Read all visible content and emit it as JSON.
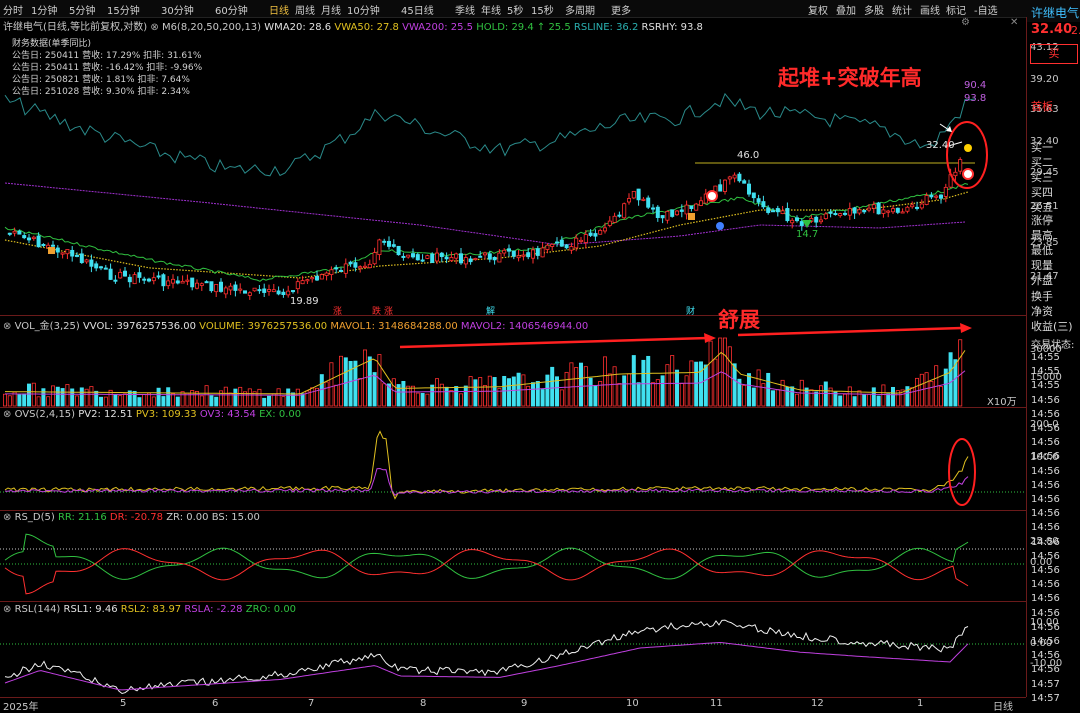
{
  "toolbar": {
    "periods": [
      "分时",
      "1分钟",
      "5分钟",
      "15分钟",
      "30分钟",
      "60分钟",
      "日线",
      "周线",
      "月线",
      "10分钟",
      "45日线",
      "季线",
      "年线",
      "5秒",
      "15秒",
      "多周期",
      "更多"
    ],
    "active_index": 6,
    "right_items": [
      "复权",
      "叠加",
      "多股",
      "统计",
      "画线",
      "标记"
    ],
    "watchlist_btn": "-自选"
  },
  "stock": {
    "name": "许继电气",
    "price": "32.40",
    "price_suffix": "2.",
    "buy_btn": "买",
    "first_board": "首板"
  },
  "main_pane": {
    "title": "许继电气(日线,等比前复权,对数)",
    "ma_title": "M6(8,20,50,200,13)",
    "wma20": "WMA20: 28.6",
    "vwa50": "VWA50: 27.8",
    "vwa200": "VWA200: 25.5",
    "hold": "HOLD: 29.4 ↑ 25.5",
    "rsline": "RSLINE: 36.2",
    "rsrhy": "RSRHY: 93.8",
    "fin_title": "财务数据(单季同比)",
    "fin_rows": [
      "公告日: 250411  营收: 17.29%  扣非: 31.61%",
      "公告日: 250411  营收: -16.42%  扣非: -9.96%",
      "公告日: 250821  营收: 1.81%  扣非: 7.64%",
      "公告日: 251028  营收: 9.30%  扣非: 2.34%"
    ],
    "yticks": [
      "43.12",
      "39.20",
      "35.63",
      "32.40",
      "29.45",
      "26.51",
      "23.85",
      "21.47"
    ],
    "marks": {
      "high_46": "46.0",
      "low_1989": "19.89",
      "low_147": "14.7",
      "price_3240": "32.40",
      "rs_904": "90.4",
      "rs_938": "93.8"
    },
    "event_tags": [
      "涨",
      "跌",
      "涨",
      "解",
      "财"
    ]
  },
  "vol_pane": {
    "title": "VOL_金(3,25)",
    "vvol": "VVOL: 3976257536.00",
    "volume": "VOLUME: 3976257536.00",
    "mavol1": "MAVOL1: 3148684288.00",
    "mavol2": "MAVOL2: 1406546944.00",
    "yticks": [
      "30000",
      "15000"
    ],
    "unit": "X10万"
  },
  "ovs_pane": {
    "title": "OVS(2,4,15)",
    "pv2": "PV2: 12.51",
    "pv3": "PV3: 109.33",
    "ov3": "OV3: 43.54",
    "ex": "EX: 0.00",
    "yticks": [
      "200.0",
      "100.0"
    ]
  },
  "rsd_pane": {
    "title": "RS_D(5)",
    "rr": "RR: 21.16",
    "dr": "DR: -20.78",
    "zr": "ZR: 0.00",
    "bs": "BS: 15.00",
    "yticks": [
      "25.00",
      "0.00"
    ]
  },
  "rsl_pane": {
    "title": "RSL(144)",
    "rsl1": "RSL1: 9.46",
    "rsl2": "RSL2: 83.97",
    "rsla": "RSLA: -2.28",
    "zro": "ZRO: 0.00",
    "yticks": [
      "10.00",
      "0.00",
      "-10.00"
    ]
  },
  "xaxis": {
    "labels": [
      "2025年",
      "5",
      "6",
      "7",
      "8",
      "9",
      "10",
      "11",
      "12",
      "1"
    ],
    "period": "日线"
  },
  "side_panel": {
    "book": [
      "买一",
      "买二",
      "买三",
      "买四",
      "买五"
    ],
    "stats": [
      "涨停",
      "最高",
      "最低",
      "现量",
      "外盘",
      "换手",
      "净资",
      "收益(三)",
      "交易状态:"
    ],
    "times": [
      "14:55",
      "14:55",
      "14:55",
      "14:56",
      "14:56",
      "14:56",
      "14:56",
      "14:56",
      "14:56",
      "14:56",
      "14:56",
      "14:56",
      "14:56",
      "14:56",
      "14:56",
      "14:56",
      "14:56",
      "14:56",
      "14:56",
      "14:56",
      "14:56",
      "14:56",
      "14:56",
      "14:57",
      "14:57"
    ]
  },
  "annotations": {
    "breakout": "起堆+突破年高",
    "stretch": "舒展"
  },
  "colors": {
    "up": "#ff3030",
    "down": "#40e0f0",
    "ma_green": "#30c040",
    "ma_yellow": "#e0c020",
    "ma_purple": "#c040e0",
    "rs_line": "#2a8a8a",
    "annotation_red": "#ff2020"
  }
}
